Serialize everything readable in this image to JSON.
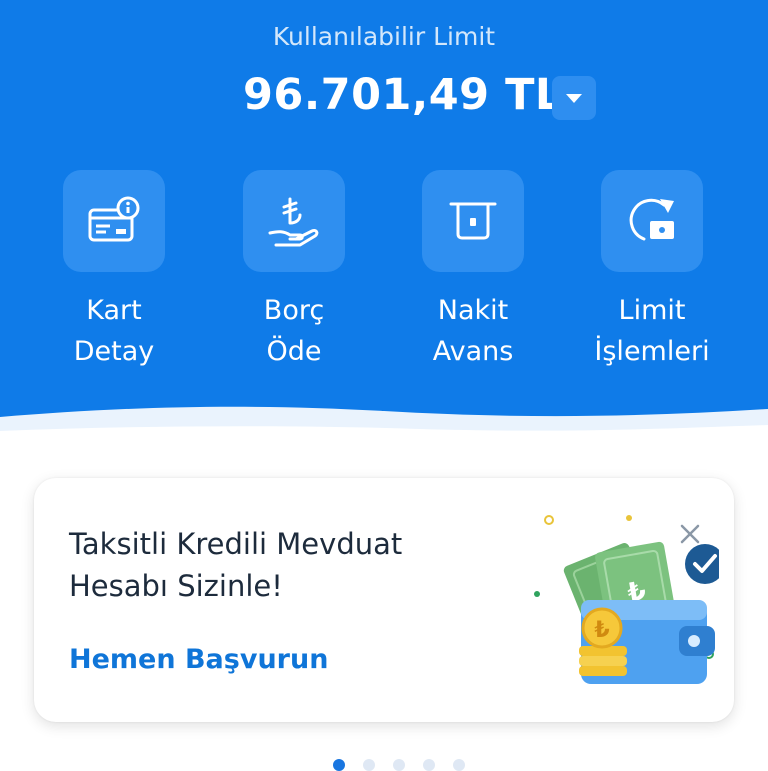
{
  "header": {
    "limit_label": "Kullanılabilir Limit",
    "limit_value": "96.701,49 TL"
  },
  "actions": [
    {
      "line1": "Kart",
      "line2": "Detay",
      "icon": "card-info-icon"
    },
    {
      "line1": "Borç",
      "line2": "Öde",
      "icon": "lira-hand-icon"
    },
    {
      "line1": "Nakit",
      "line2": "Avans",
      "icon": "atm-cash-icon"
    },
    {
      "line1": "Limit",
      "line2": "İşlemleri",
      "icon": "limit-refresh-icon"
    }
  ],
  "promo": {
    "title_line1": "Taksitli Kredili Mevduat",
    "title_line2": "Hesabı Sizinle!",
    "cta": "Hemen Başvurun",
    "illustration": "wallet-money-illustration"
  },
  "pager": {
    "count": 5,
    "active_index": 0
  },
  "colors": {
    "primary": "#0f7be8",
    "tile": "#2f8ff0",
    "cta": "#0f75d8",
    "title": "#1d2b3c"
  }
}
